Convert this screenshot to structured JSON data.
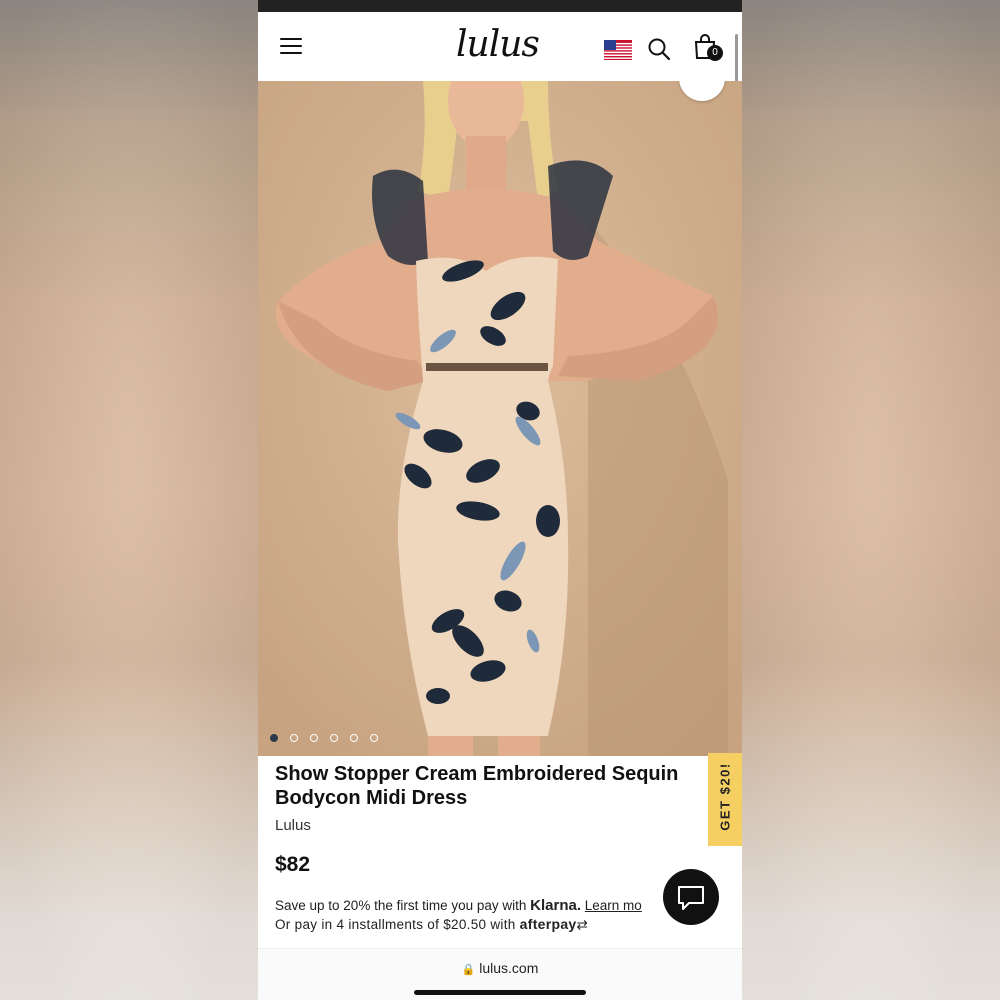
{
  "header": {
    "logo": "lulus",
    "cart_count": "0"
  },
  "product": {
    "title": "Show Stopper Cream Embroidered Sequin Bodycon Midi Dress",
    "brand": "Lulus",
    "price": "$82",
    "image_dots_total": 6,
    "image_dots_active": 1
  },
  "payments": {
    "klarna_prefix": "Save up to 20% the first time you pay with",
    "klarna_brand": "Klarna.",
    "klarna_link": "Learn mo",
    "afterpay_prefix": "Or pay in 4 installments of $20.50 with",
    "afterpay_brand": "afterpay"
  },
  "promo": {
    "label": "GET $20!"
  },
  "browser": {
    "url": "lulus.com"
  },
  "colors": {
    "promo_bg": "#f6cf63",
    "dot_active": "#2b3a4a",
    "text": "#111111"
  }
}
